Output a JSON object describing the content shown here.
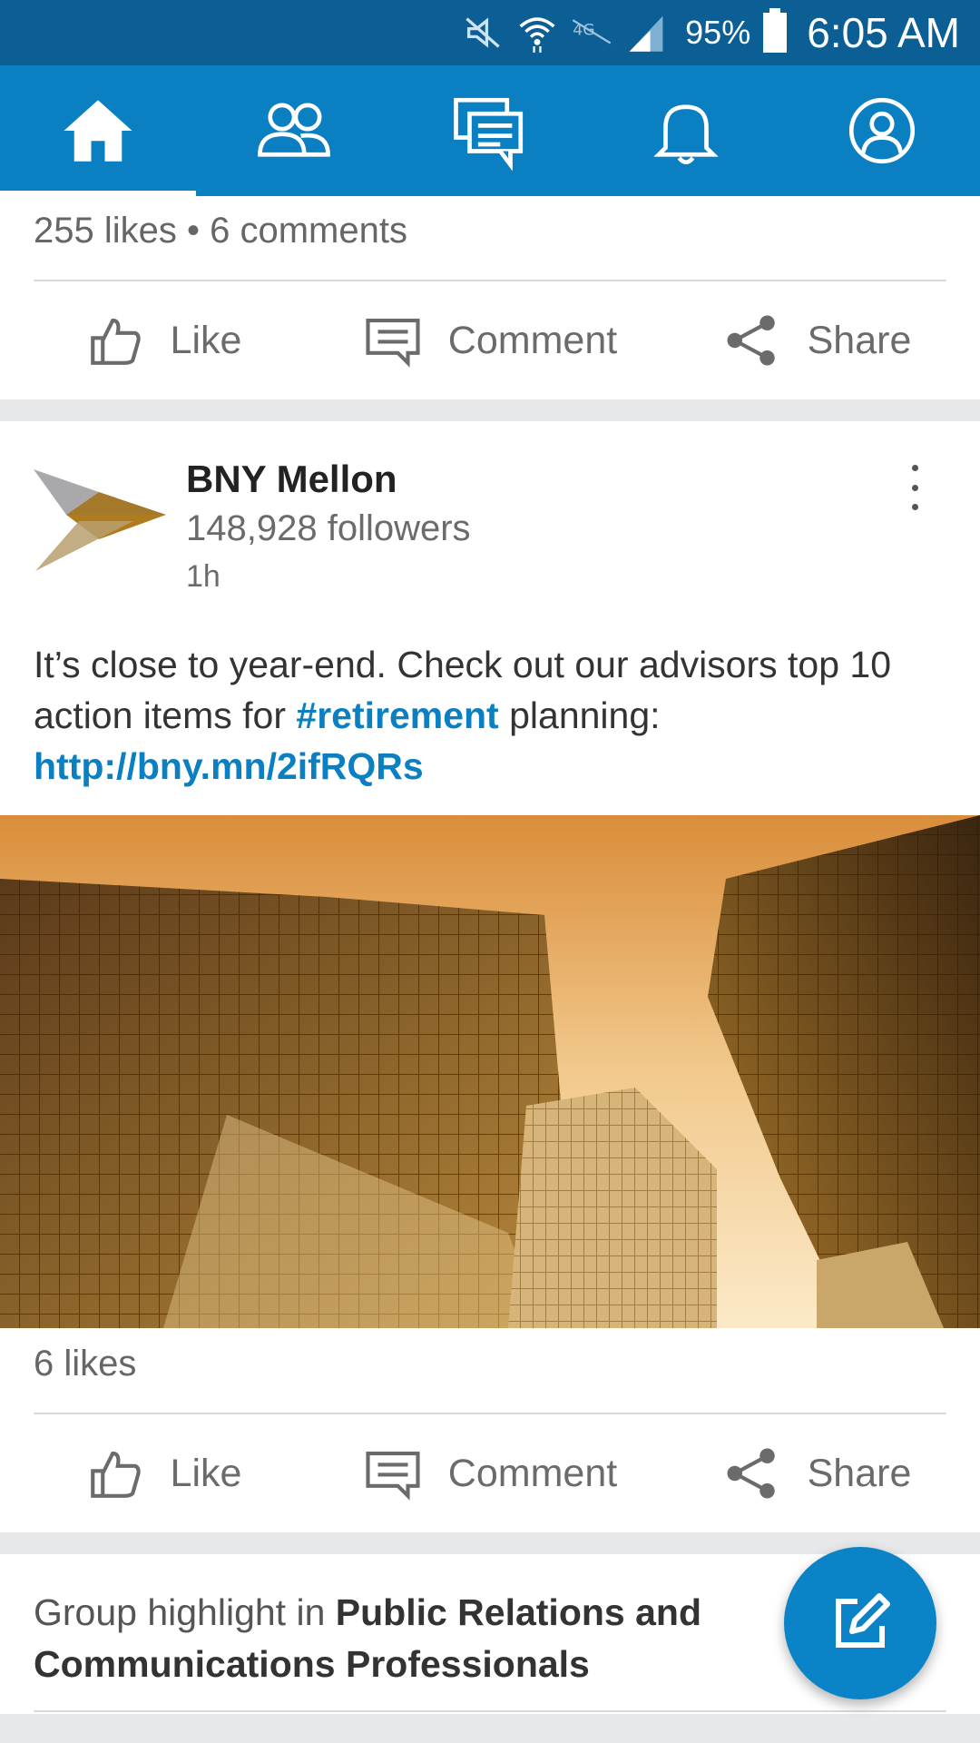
{
  "status_bar": {
    "battery": "95%",
    "time": "6:05 AM",
    "icons": [
      "mute-icon",
      "wifi-icon",
      "lte-icon",
      "signal-icon",
      "battery-icon"
    ]
  },
  "nav": {
    "tabs": [
      {
        "name": "home",
        "icon": "home-icon",
        "active": true
      },
      {
        "name": "network",
        "icon": "people-icon",
        "active": false
      },
      {
        "name": "messages",
        "icon": "messages-icon",
        "active": false
      },
      {
        "name": "notifications",
        "icon": "bell-icon",
        "active": false
      },
      {
        "name": "profile",
        "icon": "profile-icon",
        "active": false
      }
    ],
    "accent": "#0a7fc2"
  },
  "previous_post": {
    "counts": "255 likes • 6 comments",
    "actions": {
      "like": "Like",
      "comment": "Comment",
      "share": "Share"
    }
  },
  "post": {
    "author": "BNY Mellon",
    "followers": "148,928 followers",
    "time": "1h",
    "text_before": "It’s close to year-end. Check out our advisors top 10 action items for ",
    "hashtag": "#retirement",
    "text_middle": " planning: ",
    "link": "http://bny.mn/2ifRQRs",
    "image_description": "skyscrapers-image",
    "counts": "6 likes",
    "actions": {
      "like": "Like",
      "comment": "Comment",
      "share": "Share"
    }
  },
  "group_highlight": {
    "prefix": "Group highlight in ",
    "group_name": "Public Relations and Communications Professionals"
  },
  "fab": {
    "icon": "compose-icon"
  }
}
